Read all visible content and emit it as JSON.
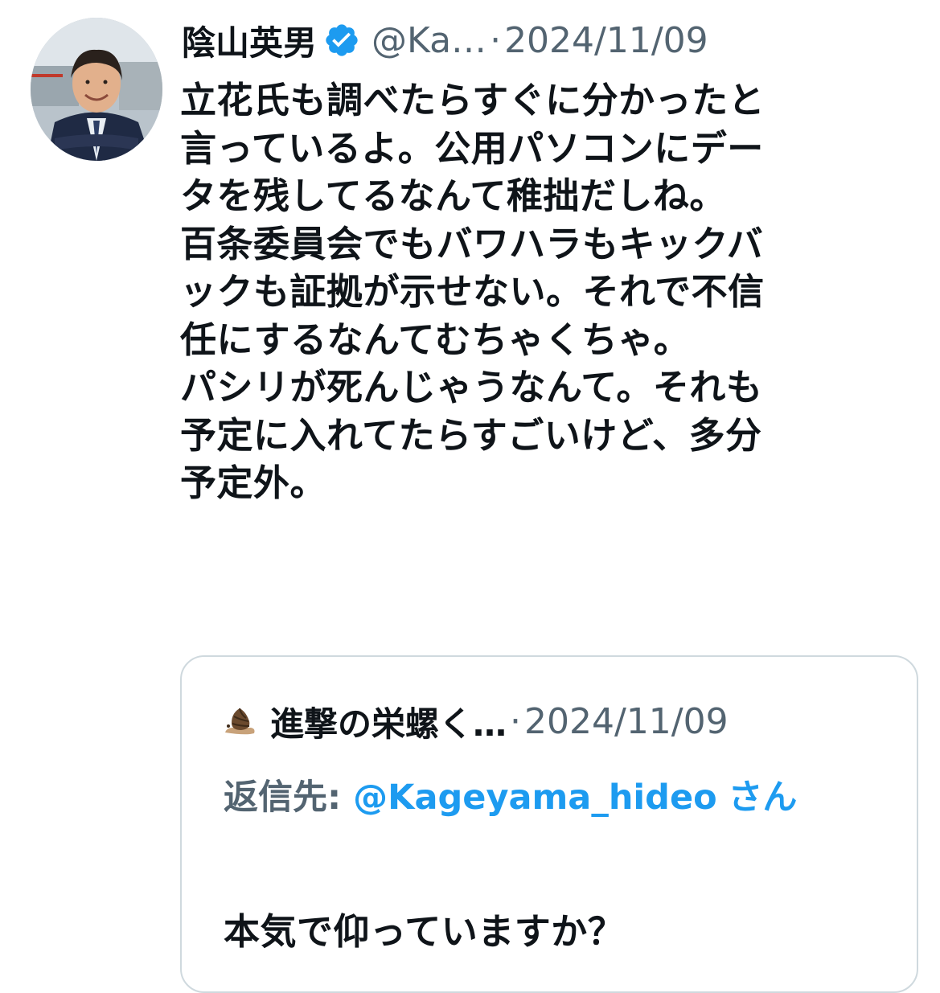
{
  "tweet": {
    "author_name": "陰山英男",
    "handle": "@Ka…",
    "separator": "·",
    "date": "2024/11/09",
    "verified_color": "#1d9bf0",
    "body_lines": [
      "立花氏も調べたらすぐに分かったと",
      "言っているよ。公用パソコンにデー",
      "タを残してるなんて稚拙だしね。",
      "百条委員会でもバワハラもキックバ",
      "ックも証拠が示せない。それで不信",
      "任にするなんてむちゃくちゃ。",
      "パシリが死んじゃうなんて。それも",
      "予定に入れてたらすごいけど、多分",
      "予定外。"
    ]
  },
  "quoted_tweet": {
    "author_name": "進撃の栄螺く…",
    "separator": "·",
    "date": "2024/11/09",
    "reply_label": "返信先: ",
    "reply_handle": "@Kageyama_hideo",
    "reply_suffix": "さん",
    "text": "本気で仰っていますか？"
  },
  "colors": {
    "text_primary": "#0f1419",
    "text_secondary": "#536471",
    "link": "#1d9bf0",
    "border": "#cfd9de"
  }
}
